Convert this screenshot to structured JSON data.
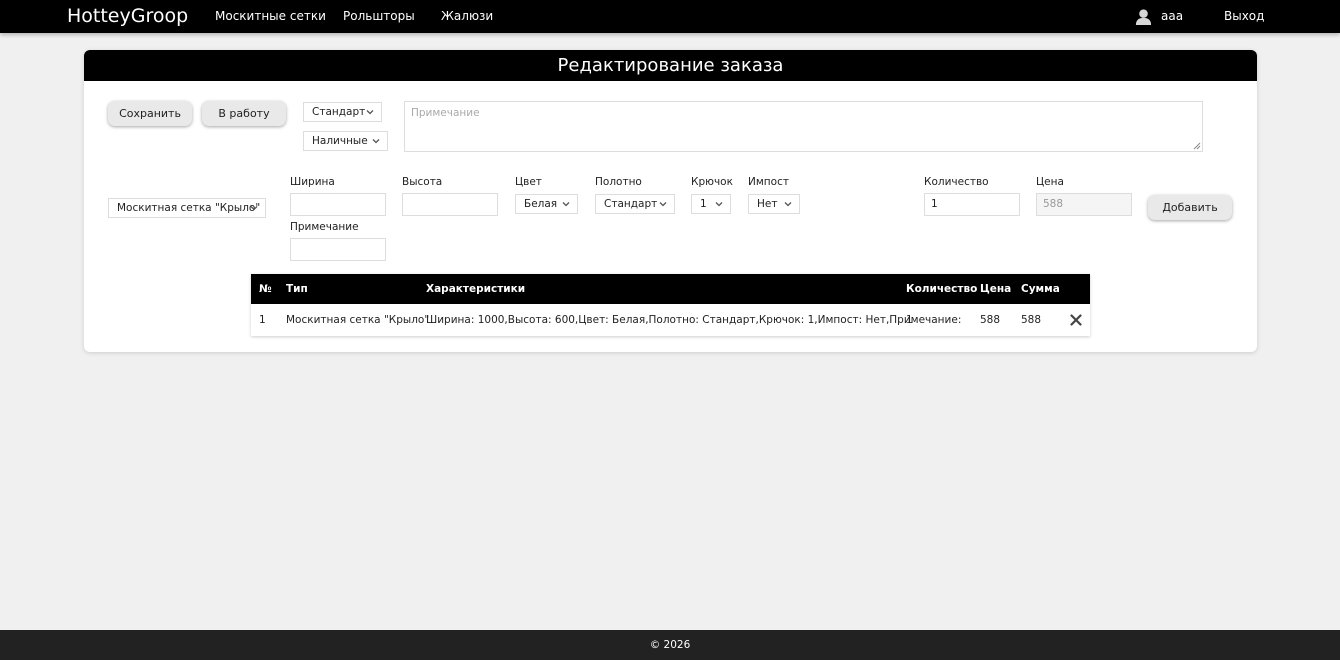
{
  "navbar": {
    "brand": "HotteyGroop",
    "links": [
      "Москитные сетки",
      "Рольшторы",
      "Жалюзи"
    ],
    "user": "aaa",
    "logout": "Выход"
  },
  "page": {
    "title": "Редактирование заказа"
  },
  "toolbar": {
    "save_label": "Сохранить",
    "work_label": "В работу",
    "type_select": "Стандарт",
    "payment_select": "Наличные",
    "note_placeholder": "Примечание"
  },
  "form": {
    "product_select": "Москитная сетка \"Крыло\"",
    "width_label": "Ширина",
    "width_value": "",
    "height_label": "Высота",
    "height_value": "",
    "note_label": "Примечание",
    "note_value": "",
    "color_label": "Цвет",
    "color_value": "Белая",
    "canvas_label": "Полотно",
    "canvas_value": "Стандарт",
    "hook_label": "Крючок",
    "hook_value": "1",
    "impost_label": "Импост",
    "impost_value": "Нет",
    "qty_label": "Количество",
    "qty_value": "1",
    "price_label": "Цена",
    "price_placeholder": "588",
    "add_label": "Добавить"
  },
  "table": {
    "headers": [
      "№",
      "Тип",
      "Характеристики",
      "Количество",
      "Цена",
      "Сумма"
    ],
    "rows": [
      {
        "num": "1",
        "type": "Москитная сетка \"Крыло\"",
        "specs": "Ширина: 1000,Высота: 600,Цвет: Белая,Полотно: Стандарт,Крючок: 1,Импост: Нет,Примечание:",
        "qty": "1",
        "price": "588",
        "sum": "588"
      }
    ]
  },
  "footer": {
    "text": "© 2026"
  },
  "icons": {
    "avatar": "user-icon",
    "chevron": "chevron-down-icon",
    "delete": "close-icon",
    "resize": "resize-grip-icon"
  }
}
